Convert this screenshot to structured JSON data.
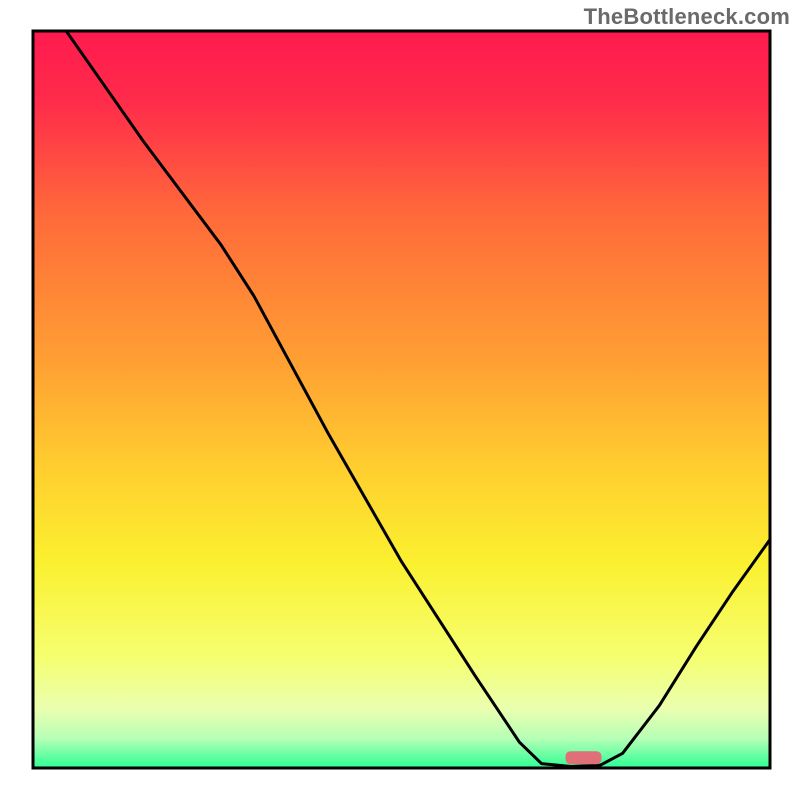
{
  "watermark": "TheBottleneck.com",
  "chart_data": {
    "type": "line",
    "title": "",
    "xlabel": "",
    "ylabel": "",
    "xlim": [
      0,
      100
    ],
    "ylim": [
      0,
      100
    ],
    "grid": false,
    "legend": false,
    "annotations": [],
    "gradient_stops": [
      {
        "pct": 0,
        "color": "#ff1a4f"
      },
      {
        "pct": 10,
        "color": "#ff2d4a"
      },
      {
        "pct": 25,
        "color": "#ff6a3a"
      },
      {
        "pct": 45,
        "color": "#ffa033"
      },
      {
        "pct": 60,
        "color": "#ffd02f"
      },
      {
        "pct": 72,
        "color": "#fbf02f"
      },
      {
        "pct": 85,
        "color": "#f5ff70"
      },
      {
        "pct": 92,
        "color": "#eaffb0"
      },
      {
        "pct": 96,
        "color": "#b6ffb6"
      },
      {
        "pct": 100,
        "color": "#2dff94"
      }
    ],
    "curve_points_xy": [
      [
        4.5,
        100
      ],
      [
        15,
        85
      ],
      [
        25.5,
        71
      ],
      [
        30,
        64
      ],
      [
        40,
        45.5
      ],
      [
        50,
        28
      ],
      [
        60,
        12.5
      ],
      [
        66,
        3.5
      ],
      [
        69,
        0.6
      ],
      [
        73,
        0.2
      ],
      [
        77,
        0.4
      ],
      [
        80,
        2.0
      ],
      [
        85,
        8.5
      ],
      [
        90,
        16.5
      ],
      [
        95,
        24
      ],
      [
        100,
        31
      ]
    ],
    "marker": {
      "x": 74.7,
      "y": 1.4,
      "color": "#e07078"
    },
    "frame_color": "#000000"
  }
}
